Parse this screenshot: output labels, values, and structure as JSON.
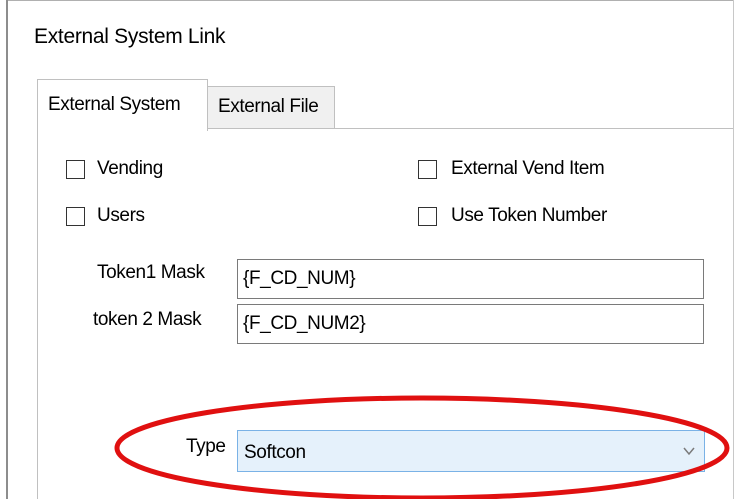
{
  "window": {
    "title": "External System Link"
  },
  "tabs": [
    {
      "label": "External System",
      "active": true
    },
    {
      "label": "External File",
      "active": false
    }
  ],
  "checkboxes": {
    "vending": {
      "label": "Vending",
      "checked": false
    },
    "users": {
      "label": "Users",
      "checked": false
    },
    "external_vend_item": {
      "label": "External Vend Item",
      "checked": false
    },
    "use_token_number": {
      "label": "Use Token Number",
      "checked": false
    }
  },
  "fields": {
    "token1_mask": {
      "label": "Token1 Mask",
      "value": "{F_CD_NUM}"
    },
    "token2_mask": {
      "label": "token 2 Mask",
      "value": "{F_CD_NUM2}"
    },
    "type": {
      "label": "Type",
      "value": "Softcon"
    }
  },
  "colors": {
    "annotation": "#e01010",
    "select_background": "#e5f1fb",
    "select_border": "#7ab2e6"
  },
  "icons": {
    "dropdown": "chevron-down-icon"
  }
}
